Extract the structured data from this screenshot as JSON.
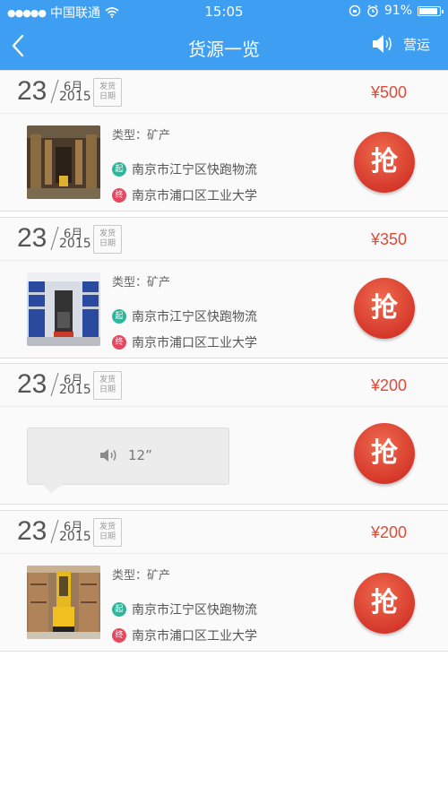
{
  "status": {
    "carrier": "中国联通",
    "time": "15:05",
    "battery": "91%",
    "battery_level": 0.91
  },
  "nav": {
    "title": "货源一览",
    "voice_label": "营运"
  },
  "cards": [
    {
      "day": "23",
      "month": "6月",
      "year": "2015",
      "ship_label_1": "发货",
      "ship_label_2": "日期",
      "price": "¥500",
      "type": "类型：矿产",
      "from_badge": "起",
      "from": "南京市江宁区快跑物流",
      "to_badge": "终",
      "to": "南京市浦口区工业大学",
      "grab": "抢"
    },
    {
      "day": "23",
      "month": "6月",
      "year": "2015",
      "ship_label_1": "发货",
      "ship_label_2": "日期",
      "price": "¥350",
      "type": "类型：矿产",
      "from_badge": "起",
      "from": "南京市江宁区快跑物流",
      "to_badge": "终",
      "to": "南京市浦口区工业大学",
      "grab": "抢"
    },
    {
      "day": "23",
      "month": "6月",
      "year": "2015",
      "ship_label_1": "发货",
      "ship_label_2": "日期",
      "price": "¥200",
      "voice_duration": "12”",
      "grab": "抢"
    },
    {
      "day": "23",
      "month": "6月",
      "year": "2015",
      "ship_label_1": "发货",
      "ship_label_2": "日期",
      "price": "¥200",
      "type": "类型：矿产",
      "from_badge": "起",
      "from": "南京市江宁区快跑物流",
      "to_badge": "终",
      "to": "南京市浦口区工业大学",
      "grab": "抢"
    }
  ],
  "icons": {
    "back": "chevron-left-icon",
    "voice": "speaker-icon",
    "wifi": "wifi-icon",
    "alarm": "alarm-icon",
    "lock": "orientation-lock-icon"
  },
  "colors": {
    "primary": "#3e9ef1",
    "price": "#e04a36",
    "grab": "#d6392b",
    "start": "#2fb59b",
    "end": "#e6485f"
  }
}
